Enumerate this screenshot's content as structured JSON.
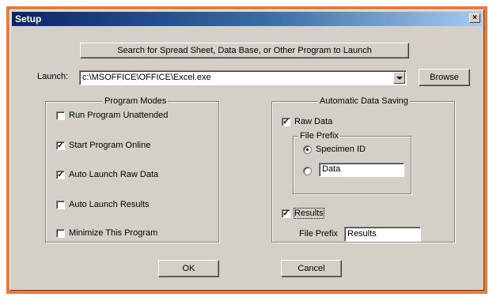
{
  "window": {
    "title": "Setup",
    "close_glyph": "×"
  },
  "search_button": {
    "label": "Search for Spread Sheet, Data Base, or Other Program to Launch"
  },
  "launch": {
    "label": "Launch:",
    "value": "c:\\MSOFFICE\\OFFICE\\Excel.exe",
    "browse_label": "Browse"
  },
  "program_modes": {
    "title": "Program Modes",
    "items": [
      {
        "label": "Run Program Unattended",
        "checked": false
      },
      {
        "label": "Start Program Online",
        "checked": true
      },
      {
        "label": "Auto Launch Raw Data",
        "checked": true
      },
      {
        "label": "Auto Launch Results",
        "checked": false
      },
      {
        "label": "Minimize This Program",
        "checked": false
      }
    ]
  },
  "auto_saving": {
    "title": "Automatic Data Saving",
    "raw_data": {
      "label": "Raw Data",
      "checked": true
    },
    "file_prefix_group": {
      "title": "File Prefix",
      "options": [
        {
          "label": "Specimen ID",
          "selected": true
        },
        {
          "label": "",
          "selected": false
        }
      ],
      "custom_value": "Data"
    },
    "results": {
      "label": "Results",
      "checked": true
    },
    "results_prefix": {
      "label": "File Prefix",
      "value": "Results"
    }
  },
  "footer": {
    "ok_label": "OK",
    "cancel_label": "Cancel"
  },
  "colors": {
    "frame": "#f0773a",
    "dialog": "#d4d0c8",
    "title_start": "#0a246a",
    "title_end": "#a6caf0"
  },
  "check_glyph": "✓"
}
